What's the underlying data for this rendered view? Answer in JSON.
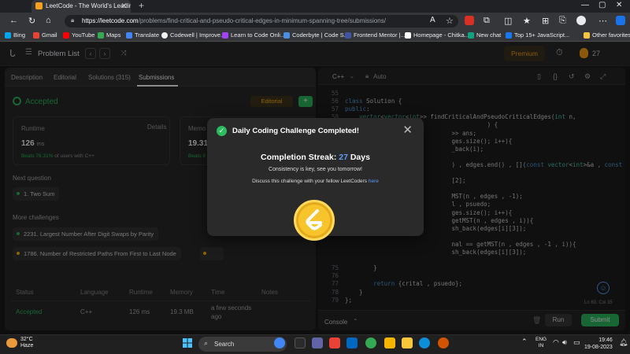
{
  "browser": {
    "tab_title": "LeetCode - The World's Leading",
    "url_host": "https://leetcode.com",
    "url_path": "/problems/find-critical-and-pseudo-critical-edges-in-minimum-spanning-tree/submissions/",
    "new_tab": "+",
    "bookmarks": [
      "Bing",
      "Gmail",
      "YouTube",
      "Maps",
      "Translate",
      "Codewell | Improve...",
      "Learn to Code Onli...",
      "Coderbyte | Code S...",
      "Frontend Mentor |...",
      "Homepage - Chitka...",
      "New chat",
      "Top 15+ JavaScript...",
      "Other favorites"
    ]
  },
  "header": {
    "problem_list": "Problem List",
    "premium": "Premium",
    "streak_count": "27"
  },
  "left": {
    "tabs": [
      "Description",
      "Editorial",
      "Solutions (315)",
      "Submissions"
    ],
    "status": "Accepted",
    "editorial_btn": "Editorial",
    "plus": "+",
    "runtime_label": "Runtime",
    "details": "Details",
    "runtime_value": "126",
    "runtime_unit": "ms",
    "runtime_beats": "Beats 76.31%",
    "runtime_beats_suffix": "of users with C++",
    "memory_label": "Memo",
    "memory_value": "19.31",
    "memory_beats": "Beats 8",
    "next_question": "Next question",
    "next_q_item": "1. Two Sum",
    "more_challenges": "More challenges",
    "challenge1": "2231. Largest Number After Digit Swaps by Parity",
    "challenge2": "1786. Number of Restricted Paths From First to Last Node",
    "table_headers": [
      "Status",
      "Language",
      "Runtime",
      "Memory",
      "Time",
      "Notes"
    ],
    "row": {
      "status": "Accepted",
      "language": "C++",
      "runtime": "126 ms",
      "memory": "19.3 MB",
      "time": "a few seconds ago"
    }
  },
  "editor": {
    "language": "C++",
    "mode": "Auto",
    "lines": [
      {
        "n": "55",
        "t": ""
      },
      {
        "n": "56",
        "t": "class Solution {"
      },
      {
        "n": "57",
        "t": "public:"
      },
      {
        "n": "58",
        "t": "    vector<vector<int>> findCriticalAndPseudoCriticalEdges(int n,"
      },
      {
        "n": "",
        "t": "                                        ) {"
      },
      {
        "n": "",
        "t": "                              >> ans;"
      },
      {
        "n": "",
        "t": "                              ges.size(); i++){"
      },
      {
        "n": "",
        "t": "                              _back(i);"
      },
      {
        "n": "",
        "t": ""
      },
      {
        "n": "",
        "t": "                              ) , edges.end() , [](const vector<int>&a , const"
      },
      {
        "n": "",
        "t": ""
      },
      {
        "n": "",
        "t": "                              [2];"
      },
      {
        "n": "",
        "t": ""
      },
      {
        "n": "",
        "t": "                              MST(n , edges , -1);"
      },
      {
        "n": "",
        "t": "                              l , psuedo;"
      },
      {
        "n": "",
        "t": "                              ges.size(); i++){"
      },
      {
        "n": "",
        "t": "                              getMST(n , edges , i)){"
      },
      {
        "n": "",
        "t": "                              sh_back(edges[i][3]);"
      },
      {
        "n": "",
        "t": ""
      },
      {
        "n": "",
        "t": "                              nal == getMST(n , edges , -1 , i)){"
      },
      {
        "n": "",
        "t": "                              sh_back(edges[i][3]);"
      },
      {
        "n": "",
        "t": ""
      },
      {
        "n": "75",
        "t": "        }"
      },
      {
        "n": "76",
        "t": ""
      },
      {
        "n": "77",
        "t": "        return {crital , psuedo};"
      },
      {
        "n": "78",
        "t": "    }"
      },
      {
        "n": "79",
        "t": "};"
      }
    ],
    "cursor": "Ln 60, Col 35",
    "console": "Console",
    "run": "Run",
    "submit": "Submit"
  },
  "modal": {
    "title": "Daily Coding Challenge Completed!",
    "streak_prefix": "Completion Streak:",
    "streak_num": "27",
    "streak_suffix": "Days",
    "msg1": "Consistency is key, see you tomorrow!",
    "msg2": "Discuss this challenge with your fellow LeetCoders",
    "msg2_link": "here",
    "close": "✕"
  },
  "taskbar": {
    "temp": "32°C",
    "weather": "Haze",
    "search": "Search",
    "lang1": "ENG",
    "lang2": "IN",
    "time": "19:46",
    "date": "19-08-2023"
  },
  "colors": {
    "accent_green": "#2cbb5d",
    "brand_orange": "#ffa116",
    "link_blue": "#5b9bf8"
  }
}
